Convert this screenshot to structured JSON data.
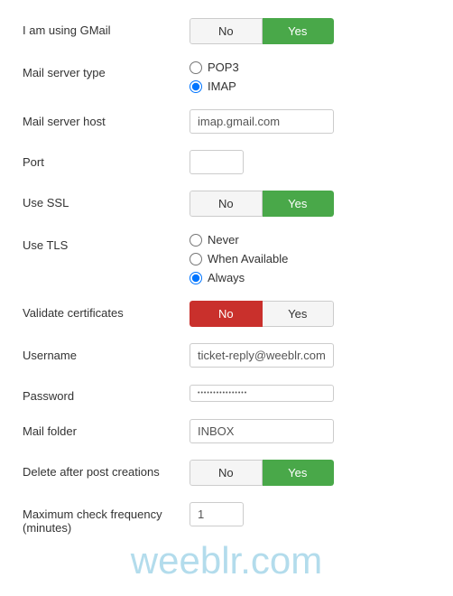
{
  "watermark": "weeblr.com",
  "rows": {
    "gmail": {
      "label": "I am using GMail",
      "no": "No",
      "yes": "Yes",
      "selected": "yes"
    },
    "serverType": {
      "label": "Mail server type",
      "options": {
        "pop3": "POP3",
        "imap": "IMAP"
      },
      "selected": "imap"
    },
    "host": {
      "label": "Mail server host",
      "value": "imap.gmail.com"
    },
    "port": {
      "label": "Port",
      "value": ""
    },
    "ssl": {
      "label": "Use SSL",
      "no": "No",
      "yes": "Yes",
      "selected": "yes"
    },
    "tls": {
      "label": "Use TLS",
      "options": {
        "never": "Never",
        "available": "When Available",
        "always": "Always"
      },
      "selected": "always"
    },
    "validate": {
      "label": "Validate certificates",
      "no": "No",
      "yes": "Yes",
      "selected": "no"
    },
    "username": {
      "label": "Username",
      "value": "ticket-reply@weeblr.com"
    },
    "password": {
      "label": "Password",
      "value": "••••••••••••••••"
    },
    "folder": {
      "label": "Mail folder",
      "value": "INBOX"
    },
    "delete": {
      "label": "Delete after post creations",
      "no": "No",
      "yes": "Yes",
      "selected": "yes"
    },
    "frequency": {
      "label": "Maximum check frequency (minutes)",
      "value": "1"
    }
  }
}
